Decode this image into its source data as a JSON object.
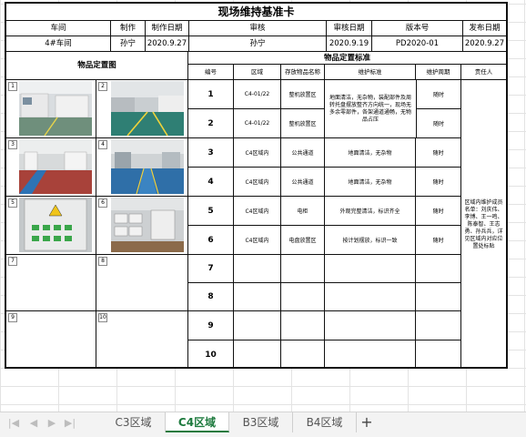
{
  "card": {
    "title": "现场维持基准卡",
    "header": {
      "labels": [
        "车间",
        "制作",
        "制作日期",
        "审核",
        "审核日期",
        "版本号",
        "发布日期"
      ],
      "values": [
        "4#车间",
        "孙宁",
        "2020.9.27",
        "孙宁",
        "2020.9.19",
        "PD2020-01",
        "2020.9.27"
      ]
    },
    "photos_title": "物品定置图",
    "photo_numbers": [
      "1",
      "2",
      "3",
      "4",
      "5",
      "6",
      "7",
      "8",
      "9",
      "10"
    ],
    "standards_title": "物品定置标准",
    "columns": [
      "编号",
      "区域",
      "存放物品名称",
      "维护标准",
      "维护周期",
      "责任人"
    ],
    "rows": [
      {
        "no": "1",
        "area": "C4-01/22",
        "item": "整机放置区",
        "cycle": "随时"
      },
      {
        "no": "2",
        "area": "C4-01/22",
        "item": "整机放置区",
        "cycle": "随时"
      },
      {
        "no": "3",
        "area": "C4区域内",
        "item": "公共通道",
        "standard": "地面清洁，无杂物",
        "cycle": "随时"
      },
      {
        "no": "4",
        "area": "C4区域内",
        "item": "公共通道",
        "standard": "地面清洁，无杂物",
        "cycle": "随时"
      },
      {
        "no": "5",
        "area": "C4区域内",
        "item": "电柜",
        "standard": "外观完整清洁，标识齐全",
        "cycle": "随时"
      },
      {
        "no": "6",
        "area": "C4区域内",
        "item": "电盘放置区",
        "standard": "按计划摆放，标识一致",
        "cycle": "随时"
      },
      {
        "no": "7"
      },
      {
        "no": "8"
      },
      {
        "no": "9"
      },
      {
        "no": "10"
      }
    ],
    "merged_standard_1_2": "地面清洁，无杂物，装配部件及周转托盘摆放整齐方向统一，现场无多余零部件，各架通道通畅，无物品占压",
    "responsible": "区域内维护成员名单：刘庆伟、李博、王一鸣、陈泰智、王志勇、孙兵兵，详见区域内对应位置处标贴"
  },
  "sheet_tabs": {
    "tabs": [
      "C3区域",
      "C4区域",
      "B3区域",
      "B4区域"
    ],
    "active": "C4区域",
    "add_label": "+"
  },
  "icons": [
    "first-sheet-icon",
    "prev-sheet-icon",
    "next-sheet-icon",
    "last-sheet-icon",
    "add-sheet-icon"
  ]
}
